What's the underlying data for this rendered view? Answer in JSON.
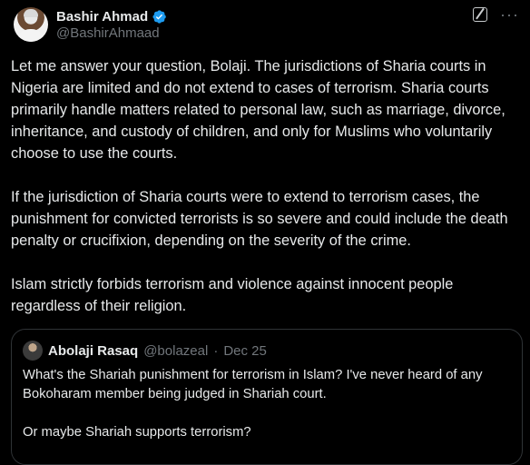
{
  "author": {
    "display_name": "Bashir Ahmad",
    "handle": "@BashirAhmaad",
    "verified": true
  },
  "icons": {
    "verified": "verified-badge-icon",
    "grok": "grok-icon",
    "more": "more-icon"
  },
  "colors": {
    "background": "#000000",
    "text": "#e7e9ea",
    "muted": "#71767b",
    "verified": "#1d9bf0",
    "border": "#2f3336"
  },
  "tweet": {
    "paragraphs": [
      "Let me answer your question, Bolaji. The jurisdictions of Sharia courts in Nigeria are limited and do not extend to cases of terrorism. Sharia courts primarily handle matters related to personal law, such as marriage, divorce, inheritance, and custody of children, and only for Muslims who voluntarily choose to use the courts.",
      "If the jurisdiction of Sharia courts were to extend to terrorism cases, the punishment for convicted terrorists is so severe and could include the death penalty or crucifixion, depending on the severity of the crime.",
      "Islam strictly forbids terrorism and violence against innocent people regardless of their religion."
    ]
  },
  "quoted": {
    "display_name": "Abolaji Rasaq",
    "handle": "@bolazeal",
    "separator": "·",
    "date": "Dec 25",
    "paragraphs": [
      "What's the Shariah punishment for terrorism in Islam? I've never heard of any Bokoharam member being judged in Shariah court.",
      "Or maybe Shariah supports terrorism?"
    ]
  }
}
